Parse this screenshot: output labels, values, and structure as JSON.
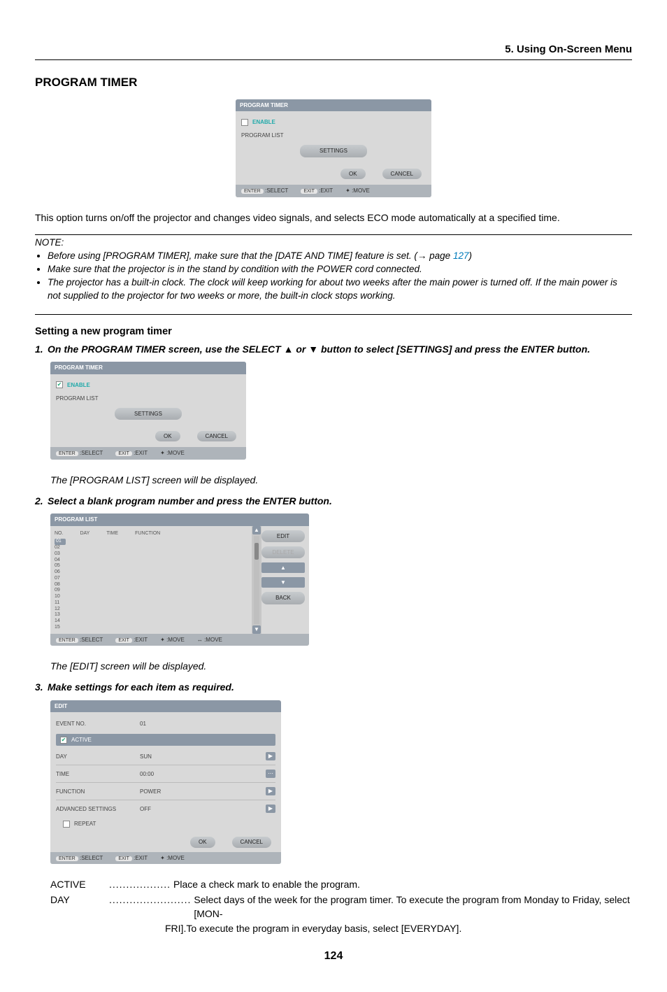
{
  "breadcrumb": "5. Using On-Screen Menu",
  "section_title": "PROGRAM TIMER",
  "panel1": {
    "title": "PROGRAM TIMER",
    "enable": "ENABLE",
    "program_list": "PROGRAM LIST",
    "settings_btn": "SETTINGS",
    "ok": "OK",
    "cancel": "CANCEL",
    "footer": {
      "select": ":SELECT",
      "exit": ":EXIT",
      "move": ":MOVE",
      "enter": "ENTER",
      "exitkey": "EXIT"
    }
  },
  "intro_text": "This option turns on/off the projector and changes video signals, and selects ECO mode automatically at a specified time.",
  "note": {
    "label": "NOTE:",
    "items": [
      {
        "pre": "Before using [PROGRAM TIMER], make sure that the [DATE AND TIME] feature is set. (→ page ",
        "link": "127",
        "post": ")"
      },
      {
        "pre": "Make sure that the projector is in the stand by condition with the POWER cord connected.",
        "link": "",
        "post": ""
      },
      {
        "pre": "The projector has a built-in clock. The clock will keep working for about two weeks after the main power is turned off. If the main power is not supplied to the projector for two weeks or more, the built-in clock stops working.",
        "link": "",
        "post": ""
      }
    ]
  },
  "subhead": "Setting a new program timer",
  "step1": {
    "n": "1.",
    "text_a": "On the PROGRAM TIMER screen, use the SELECT ",
    "tri1": "▲",
    "text_b": " or ",
    "tri2": "▼",
    "text_c": " button to select [SETTINGS] and press the ENTER button."
  },
  "panel2": {
    "title": "PROGRAM TIMER",
    "enable": "ENABLE",
    "program_list": "PROGRAM LIST",
    "settings_btn": "SETTINGS",
    "ok": "OK",
    "cancel": "CANCEL"
  },
  "caption1": "The [PROGRAM LIST] screen will be displayed.",
  "step2": {
    "n": "2.",
    "text": "Select a blank program number and press the ENTER button."
  },
  "panel3": {
    "title": "PROGRAM LIST",
    "cols": {
      "no": "NO.",
      "day": "DAY",
      "time": "TIME",
      "function": "FUNCTION"
    },
    "rows": [
      "01",
      "02",
      "03",
      "04",
      "05",
      "06",
      "07",
      "08",
      "09",
      "10",
      "11",
      "12",
      "13",
      "14",
      "15"
    ],
    "side": {
      "edit": "EDIT",
      "delete": "DELETE",
      "up": "▲",
      "down": "▼",
      "back": "BACK"
    },
    "footer": {
      "select": ":SELECT",
      "exit": ":EXIT",
      "move1": ":MOVE",
      "move2": ":MOVE"
    }
  },
  "caption2": "The [EDIT] screen will be displayed.",
  "step3": {
    "n": "3.",
    "text": "Make settings for each item as required."
  },
  "panel4": {
    "title": "EDIT",
    "event_no_lab": "EVENT NO.",
    "event_no_val": "01",
    "active": "ACTIVE",
    "rows": [
      {
        "lab": "DAY",
        "val": "SUN",
        "icon": "▶"
      },
      {
        "lab": "TIME",
        "val": "00:00",
        "icon": "⋯"
      },
      {
        "lab": "FUNCTION",
        "val": "POWER",
        "icon": "▶"
      },
      {
        "lab": "ADVANCED SETTINGS",
        "val": "OFF",
        "icon": "▶"
      }
    ],
    "repeat": "REPEAT",
    "ok": "OK",
    "cancel": "CANCEL",
    "footer": {
      "select": ":SELECT",
      "exit": ":EXIT",
      "move": ":MOVE"
    }
  },
  "descriptions": {
    "items": [
      {
        "label": "ACTIVE",
        "dots": "..................",
        "text": "Place a check mark to enable the program.",
        "cont": ""
      },
      {
        "label": "DAY",
        "dots": "........................",
        "text": "Select days of the week for the program timer. To execute the program from Monday to Friday, select [MON-",
        "cont": "FRI].To execute the program in everyday basis, select [EVERYDAY]."
      }
    ]
  },
  "page_number": "124"
}
